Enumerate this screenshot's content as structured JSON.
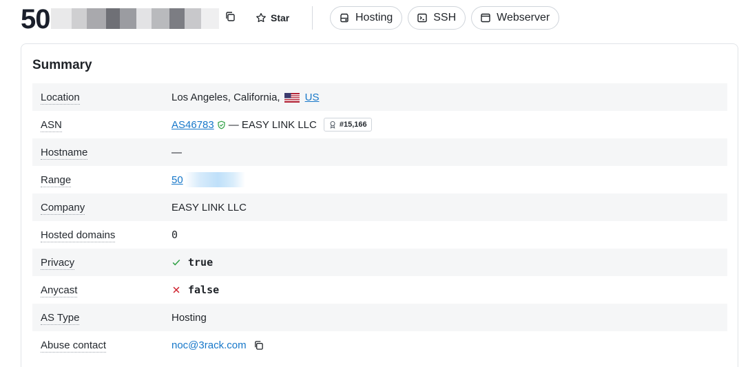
{
  "header": {
    "ip_visible": "50",
    "copy_icon": "copy-icon",
    "star_label": "Star",
    "tags": [
      {
        "label": "Hosting",
        "icon": "server-icon"
      },
      {
        "label": "SSH",
        "icon": "terminal-icon"
      },
      {
        "label": "Webserver",
        "icon": "browser-window-icon"
      }
    ]
  },
  "summary": {
    "title": "Summary",
    "location": {
      "label": "Location",
      "city": "Los Angeles, California,",
      "country": "US",
      "flag_icon": "us-flag-icon"
    },
    "asn": {
      "label": "ASN",
      "asn": "AS46783",
      "separator": "— EASY LINK LLC",
      "rank": "#15,166",
      "verified_icon": "shield-check-icon",
      "rank_icon": "award-icon"
    },
    "hostname": {
      "label": "Hostname",
      "value": "—"
    },
    "range": {
      "label": "Range",
      "value": "50"
    },
    "company": {
      "label": "Company",
      "value": "EASY LINK LLC"
    },
    "hosted_domains": {
      "label": "Hosted domains",
      "value": "0"
    },
    "privacy": {
      "label": "Privacy",
      "value": "true",
      "icon": "check-icon"
    },
    "anycast": {
      "label": "Anycast",
      "value": "false",
      "icon": "x-icon"
    },
    "as_type": {
      "label": "AS Type",
      "value": "Hosting"
    },
    "abuse_contact": {
      "label": "Abuse contact",
      "value": "noc@3rack.com",
      "icon": "copy-icon"
    }
  },
  "colors": {
    "link": "#1677c9",
    "success": "#2ea043",
    "danger": "#cf222e",
    "row_stripe": "#f5f6f7"
  }
}
